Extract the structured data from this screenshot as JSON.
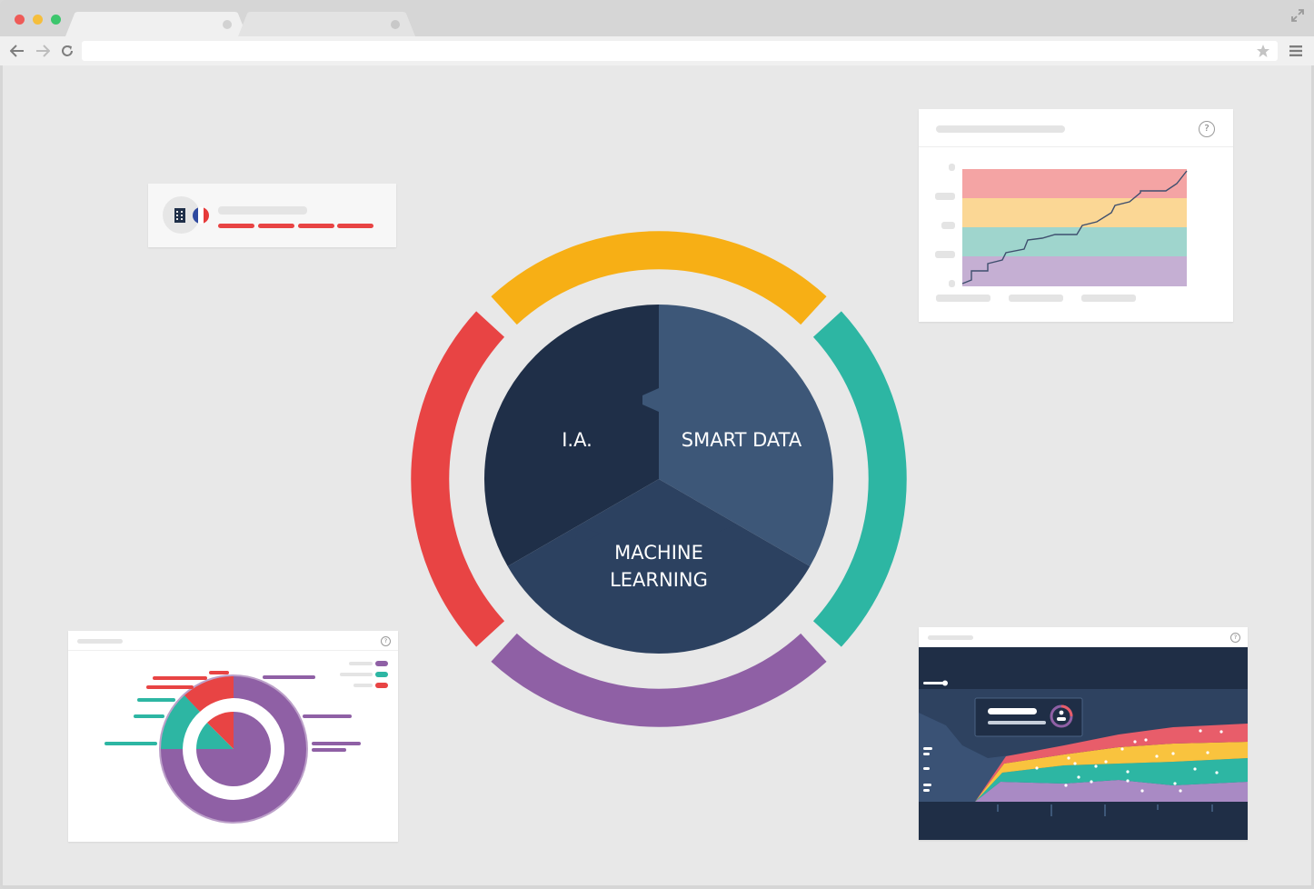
{
  "browser": {
    "star_icon": "star-icon",
    "menu_icon": "hamburger-icon",
    "fullscreen_icon": "expand-icon",
    "traffic_lights": [
      "#ee5b58",
      "#f5be3c",
      "#3cc66d"
    ]
  },
  "diagram": {
    "segments": [
      {
        "label": "I.A."
      },
      {
        "label": "SMART DATA"
      },
      {
        "label_line1": "MACHINE",
        "label_line2": "LEARNING"
      }
    ],
    "ring_colors": {
      "top": "#f7af15",
      "right": "#2db6a3",
      "bottom": "#8f60a5",
      "left": "#e84444"
    },
    "segment_colors": {
      "ia": "#1f2f48",
      "smart_data": "#3d5778",
      "machine_learning": "#2c4160"
    }
  },
  "cards": {
    "company_card": {
      "icons": [
        "building-icon",
        "france-flag-icon"
      ]
    },
    "line_chart_card": {
      "help_symbol": "?"
    },
    "donut_card": {
      "help_symbol": "?"
    },
    "stream_card": {
      "help_symbol": "?"
    }
  }
}
